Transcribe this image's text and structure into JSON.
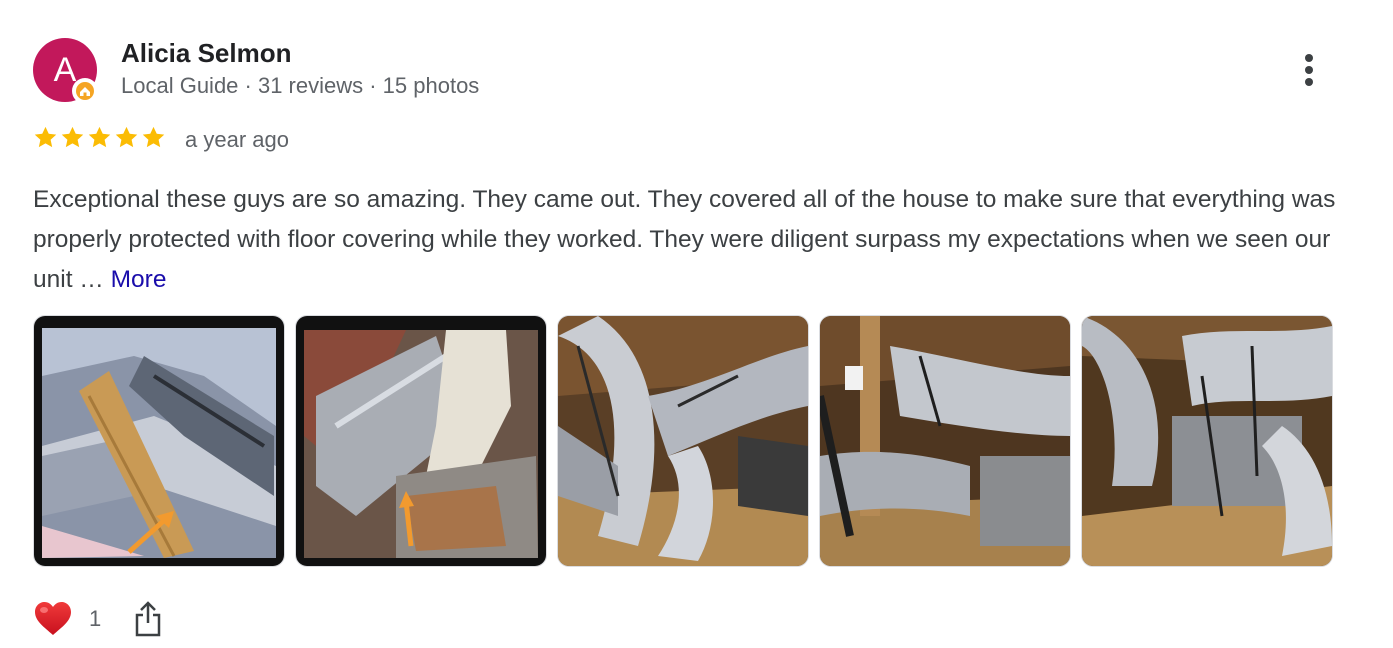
{
  "reviewer": {
    "initial": "A",
    "name": "Alicia Selmon",
    "meta": "Local Guide · 31 reviews · 15 photos",
    "avatar_color": "#c2185b"
  },
  "icons": {
    "more": "more-vert-icon",
    "guide_badge": "local-guide-badge-icon",
    "star": "star-icon",
    "reaction": "heart-icon",
    "share": "share-icon"
  },
  "rating": {
    "stars": 5,
    "max": 5,
    "color": "#fbbc04"
  },
  "time": "a year ago",
  "review": {
    "text": "Exceptional these guys are so amazing. They came out. They covered all of the house to make sure that everything was properly protected with floor covering while they worked. They were diligent surpass my expectations when we seen our unit … ",
    "more_label": "More",
    "link_color": "#1a0dab"
  },
  "photos": [
    {
      "subject": "insulated ducts with wooden beam and orange arrow"
    },
    {
      "subject": "duct connection close-up with orange arrow"
    },
    {
      "subject": "attic ductwork view 1"
    },
    {
      "subject": "attic ductwork view 2"
    },
    {
      "subject": "attic ductwork view 3"
    }
  ],
  "reactions": {
    "count": "1"
  }
}
